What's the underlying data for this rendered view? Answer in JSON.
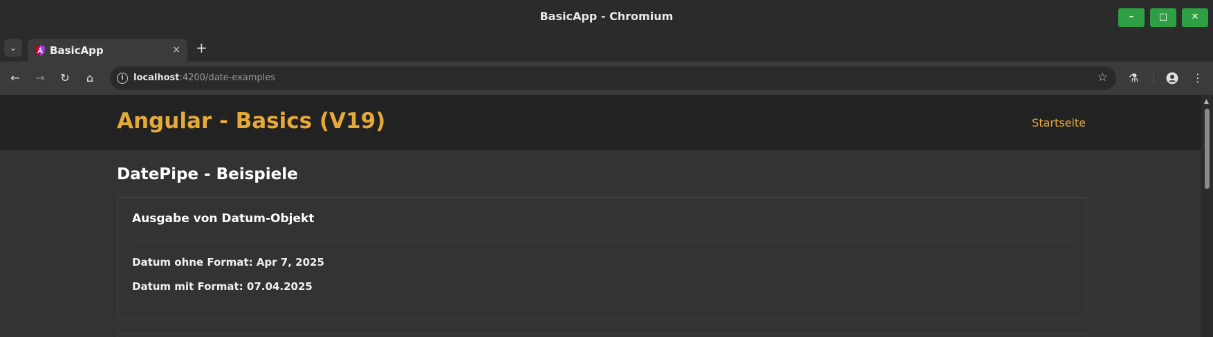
{
  "window": {
    "title": "BasicApp - Chromium",
    "controls": {
      "minimize": "–",
      "maximize": "□",
      "close": "✕"
    }
  },
  "tabs": {
    "list_button_icon": "chevron-down-icon",
    "items": [
      {
        "title": "BasicApp",
        "favicon": "angular-icon",
        "close": "×"
      }
    ],
    "new_tab": "+"
  },
  "toolbar": {
    "back": "←",
    "forward": "→",
    "reload": "↻",
    "home": "⌂",
    "url_host": "localhost",
    "url_rest": ":4200/date-examples",
    "bookmark": "☆",
    "labs": "⚗",
    "menu": "⋮"
  },
  "app": {
    "title": "Angular - Basics (V19)",
    "nav_link": "Startseite",
    "accent_color": "#e5a93a"
  },
  "page": {
    "heading": "DatePipe - Beispiele",
    "card": {
      "title": "Ausgabe von Datum-Objekt",
      "line1": "Datum ohne Format: Apr 7, 2025",
      "line2": "Datum mit Format: 07.04.2025"
    }
  },
  "colors": {
    "window_control": "#2ea043",
    "page_background": "#333333",
    "header_background": "#222222"
  }
}
